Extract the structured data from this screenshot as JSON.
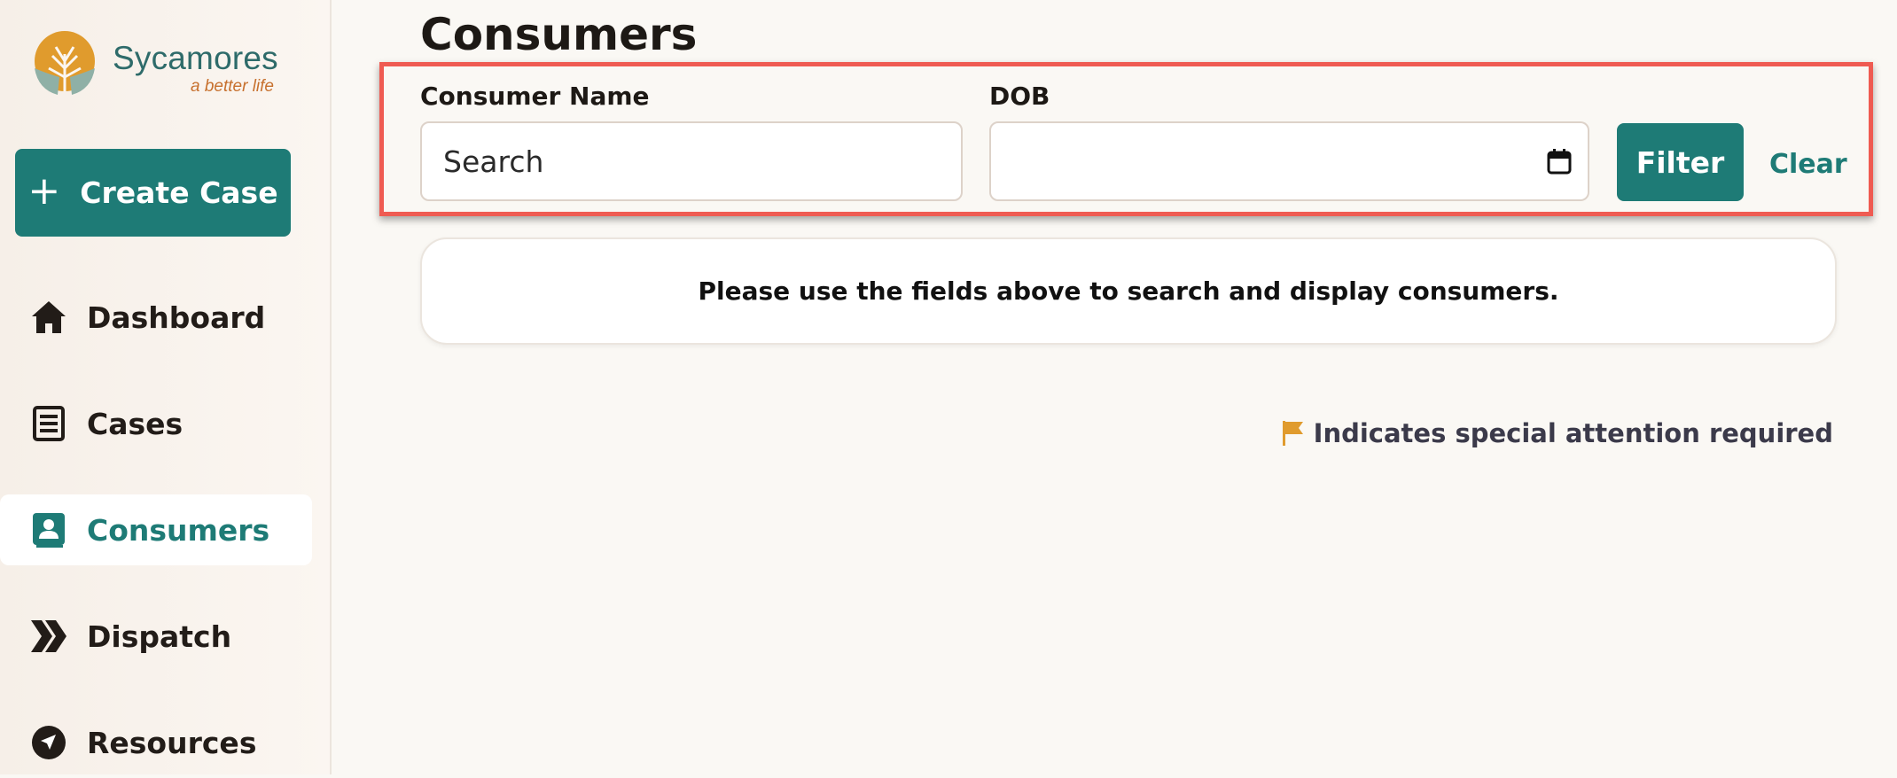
{
  "brand": {
    "name": "Sycamores",
    "tagline": "a better life",
    "colors": {
      "primary": "#1e7b76",
      "accent": "#e09b2d",
      "highlight_border": "#ef5b52"
    }
  },
  "sidebar": {
    "create_case": {
      "icon": "plus-icon",
      "label": "Create Case"
    },
    "items": [
      {
        "key": "dashboard",
        "icon": "home-icon",
        "label": "Dashboard",
        "active": false
      },
      {
        "key": "cases",
        "icon": "document-icon",
        "label": "Cases",
        "active": false
      },
      {
        "key": "consumers",
        "icon": "contact-card-icon",
        "label": "Consumers",
        "active": true
      },
      {
        "key": "dispatch",
        "icon": "double-chevron-right-icon",
        "label": "Dispatch",
        "active": false
      },
      {
        "key": "resources",
        "icon": "compass-arrow-icon",
        "label": "Resources",
        "active": false
      }
    ]
  },
  "main": {
    "title": "Consumers",
    "filters": {
      "consumer_name": {
        "label": "Consumer Name",
        "placeholder": "Search",
        "value": ""
      },
      "dob": {
        "label": "DOB",
        "value": "",
        "icon": "calendar-icon"
      },
      "filter_button": "Filter",
      "clear_link": "Clear"
    },
    "empty_message": "Please use the fields above to search and display consumers.",
    "legend": {
      "icon": "flag-icon",
      "text": "Indicates special attention required"
    }
  }
}
